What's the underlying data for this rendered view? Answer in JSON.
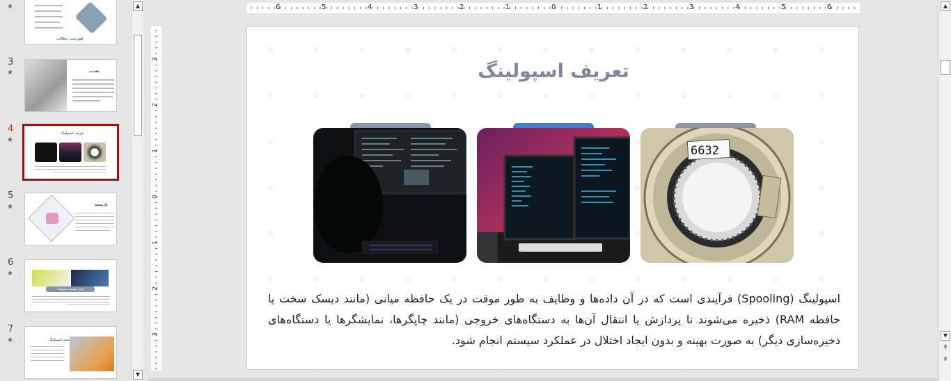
{
  "thumbnails": [
    {
      "number": "",
      "title": "فهرست مطالب",
      "starred": true
    },
    {
      "number": "3",
      "title": "مقدمه",
      "starred": true
    },
    {
      "number": "4",
      "title": "تعریف اسپولینگ",
      "starred": true,
      "selected": true
    },
    {
      "number": "5",
      "title": "تاریخچه",
      "starred": true
    },
    {
      "number": "6",
      "title": "هدف سیستم اسپولینگ",
      "starred": true
    },
    {
      "number": "7",
      "title": "اجزای سیستم اسپولینگ",
      "starred": true
    }
  ],
  "star_glyph": "★",
  "ruler": {
    "h_labels": [
      "6",
      "5",
      "4",
      "3",
      "2",
      "1",
      "0",
      "1",
      "2",
      "3",
      "4",
      "5",
      "6"
    ],
    "v_labels": [
      "3",
      "2",
      "1",
      "0",
      "1",
      "2",
      "3"
    ]
  },
  "slide": {
    "title": "تعریف اسپولینگ",
    "body": "اسپولینگ (Spooling) فرآیندی است که در آن داده‌ها و وظایف به طور موقت در یک حافظه میانی (مانند دیسک سخت یا حافظه RAM) ذخیره می‌شوند تا پردازش یا انتقال آن‌ها به دستگاه‌های خروجی (مانند چاپگرها، نمایشگرها یا دستگاه‌های ذخیره‌سازی دیگر) به صورت بهینه و بدون ایجاد اختلال در عملکرد سیستم انجام شود.",
    "photos": [
      {
        "name": "tape-reel-photo",
        "label": "6632",
        "tab_color": "#8a93a8"
      },
      {
        "name": "computer-monitors-photo",
        "tab_color": "#3d7fd1"
      },
      {
        "name": "dark-terminal-photo",
        "tab_color": "#8a93a8"
      }
    ]
  },
  "scrollbar": {
    "up_glyph": "▲",
    "down_glyph": "▼",
    "prev_glyph": "⇞",
    "next_glyph": "⇟"
  }
}
